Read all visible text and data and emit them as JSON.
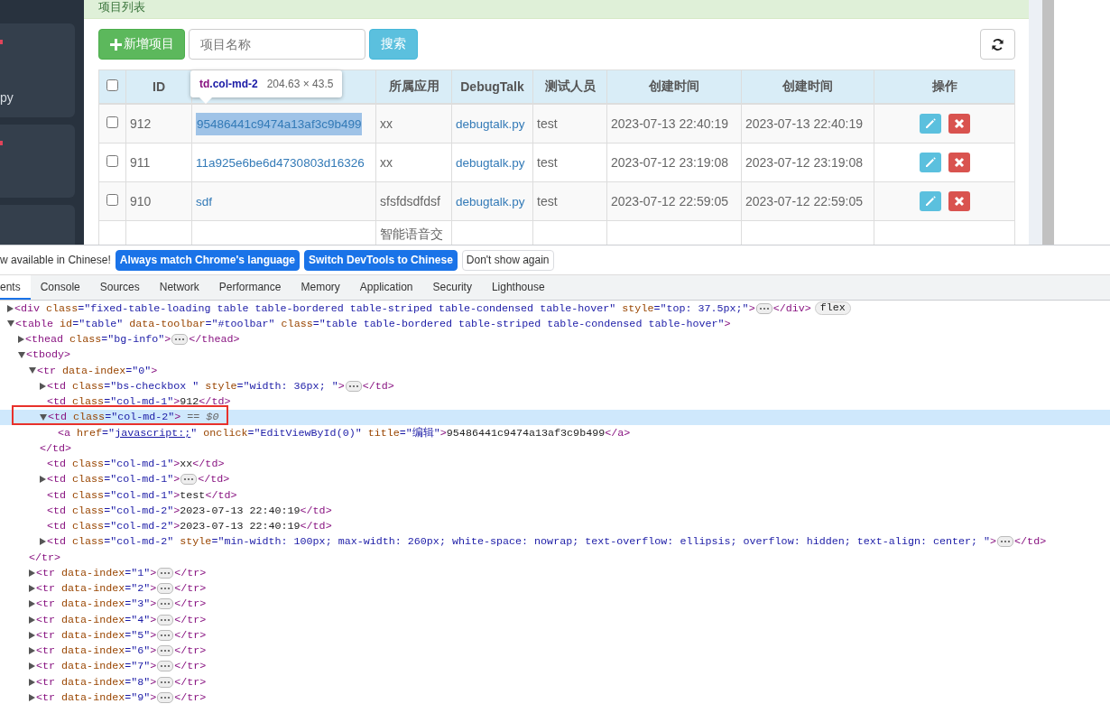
{
  "sidebar": {
    "cards": [
      {
        "label": "py",
        "marked": true
      },
      {
        "marked": true
      },
      {
        "marked": false
      }
    ]
  },
  "panel": {
    "title": "项目列表"
  },
  "toolbar": {
    "add_button": "新增项目",
    "search": {
      "placeholder": "项目名称"
    },
    "search_button": "搜索"
  },
  "table": {
    "columns": [
      {
        "kind": "checkbox",
        "checked": false
      },
      {
        "kind": "text",
        "label": "ID"
      },
      {
        "kind": "hidden"
      },
      {
        "kind": "text",
        "label": "所属应用"
      },
      {
        "kind": "text",
        "label": "DebugTalk"
      },
      {
        "kind": "text",
        "label": "测试人员"
      },
      {
        "kind": "text",
        "label": "创建时间"
      },
      {
        "kind": "text",
        "label": "创建时间"
      },
      {
        "kind": "text",
        "label": "操作"
      }
    ],
    "rows": [
      {
        "checked": false,
        "id": "912",
        "name": "95486441c9474a13af3c9b499",
        "inspected": true,
        "app": "xx",
        "debugtalk": "debugtalk.py",
        "tester": "test",
        "created": "2023-07-13 22:40:19",
        "created_2": "2023-07-13 22:40:19",
        "actions": [
          {
            "kind": "edit"
          },
          {
            "kind": "delete"
          }
        ]
      },
      {
        "checked": false,
        "id": "911",
        "name": "11a925e6be6d4730803d16326",
        "inspected": false,
        "app": "xx",
        "debugtalk": "debugtalk.py",
        "tester": "test",
        "created": "2023-07-12 23:19:08",
        "created_2": "2023-07-12 23:19:08",
        "actions": [
          {
            "kind": "edit"
          },
          {
            "kind": "delete"
          }
        ]
      },
      {
        "checked": false,
        "id": "910",
        "name": "sdf",
        "inspected": false,
        "app": "sfsfdsdfdsf",
        "debugtalk": "debugtalk.py",
        "tester": "test",
        "created": "2023-07-12 22:59:05",
        "created_2": "2023-07-12 22:59:05",
        "actions": [
          {
            "kind": "edit"
          },
          {
            "kind": "delete"
          }
        ]
      },
      {
        "app": "智能语音交",
        "inspected": false
      }
    ]
  },
  "tooltip": {
    "tag": "td",
    "selector": ".col-md-2",
    "size": "204.63 × 43.5"
  },
  "devtools": {
    "infobar": {
      "message": "w available in Chinese!",
      "buttons": [
        {
          "label": "Always match Chrome's language",
          "kind": "primary"
        },
        {
          "label": "Switch DevTools to Chinese",
          "kind": "primary"
        },
        {
          "label": "Don't show again",
          "kind": "secondary"
        }
      ]
    },
    "tabs": [
      {
        "label": "ents",
        "selected": true
      },
      {
        "label": "Console",
        "selected": false
      },
      {
        "label": "Sources",
        "selected": false
      },
      {
        "label": "Network",
        "selected": false
      },
      {
        "label": "Performance",
        "selected": false
      },
      {
        "label": "Memory",
        "selected": false
      },
      {
        "label": "Application",
        "selected": false
      },
      {
        "label": "Security",
        "selected": false
      },
      {
        "label": "Lighthouse",
        "selected": false
      }
    ],
    "tree": [
      {
        "kind": "closed",
        "selected": false,
        "boxed": false,
        "parts": [
          {
            "kind": "tag",
            "text": "<div"
          },
          {
            "kind": "attr",
            "text": " class"
          },
          {
            "kind": "value",
            "text": "=\"fixed-table-loading table table-bordered table-striped table-condensed table-hover\""
          },
          {
            "kind": "attr",
            "text": " style"
          },
          {
            "kind": "value",
            "text": "=\"top: 37.5px;\""
          },
          {
            "kind": "tag",
            "text": ">"
          },
          {
            "kind": "more"
          },
          {
            "kind": "tag",
            "text": "</div>"
          },
          {
            "kind": "badge",
            "text": "flex"
          }
        ]
      },
      {
        "kind": "open",
        "selected": false,
        "boxed": false,
        "parts": [
          {
            "kind": "tag",
            "text": "<table"
          },
          {
            "kind": "attr",
            "text": " id"
          },
          {
            "kind": "value",
            "text": "=\"table\""
          },
          {
            "kind": "attr",
            "text": " data-toolbar"
          },
          {
            "kind": "value",
            "text": "=\"#toolbar\""
          },
          {
            "kind": "attr",
            "text": " class"
          },
          {
            "kind": "value",
            "text": "=\"table table-bordered table-striped table-condensed table-hover\""
          },
          {
            "kind": "tag",
            "text": ">"
          }
        ],
        "children": [
          {
            "kind": "closed",
            "selected": false,
            "boxed": false,
            "parts": [
              {
                "kind": "tag",
                "text": "<thead"
              },
              {
                "kind": "attr",
                "text": " class"
              },
              {
                "kind": "value",
                "text": "=\"bg-info\""
              },
              {
                "kind": "tag",
                "text": ">"
              },
              {
                "kind": "more"
              },
              {
                "kind": "tag",
                "text": "</thead>"
              }
            ]
          },
          {
            "kind": "open",
            "selected": false,
            "boxed": false,
            "parts": [
              {
                "kind": "tag",
                "text": "<tbody>"
              }
            ],
            "children": [
              {
                "kind": "open",
                "selected": false,
                "boxed": false,
                "parts": [
                  {
                    "kind": "tag",
                    "text": "<tr"
                  },
                  {
                    "kind": "attr",
                    "text": " data-index"
                  },
                  {
                    "kind": "value",
                    "text": "=\"0\""
                  },
                  {
                    "kind": "tag",
                    "text": ">"
                  }
                ],
                "close": "</tr>",
                "children": [
                  {
                    "kind": "closed",
                    "selected": false,
                    "boxed": false,
                    "parts": [
                      {
                        "kind": "tag",
                        "text": "<td"
                      },
                      {
                        "kind": "attr",
                        "text": " class"
                      },
                      {
                        "kind": "value",
                        "text": "=\"bs-checkbox \""
                      },
                      {
                        "kind": "attr",
                        "text": " style"
                      },
                      {
                        "kind": "value",
                        "text": "=\"width: 36px; \""
                      },
                      {
                        "kind": "tag",
                        "text": ">"
                      },
                      {
                        "kind": "more"
                      },
                      {
                        "kind": "tag",
                        "text": "</td>"
                      }
                    ]
                  },
                  {
                    "kind": "leaf",
                    "selected": false,
                    "boxed": false,
                    "parts": [
                      {
                        "kind": "tag",
                        "text": "<td"
                      },
                      {
                        "kind": "attr",
                        "text": " class"
                      },
                      {
                        "kind": "value",
                        "text": "=\"col-md-1\""
                      },
                      {
                        "kind": "tag",
                        "text": ">"
                      },
                      {
                        "kind": "text",
                        "text": "912"
                      },
                      {
                        "kind": "tag",
                        "text": "</td>"
                      }
                    ]
                  },
                  {
                    "kind": "open",
                    "selected": true,
                    "boxed": true,
                    "parts": [
                      {
                        "kind": "tag",
                        "text": "<td"
                      },
                      {
                        "kind": "attr",
                        "text": " class"
                      },
                      {
                        "kind": "value",
                        "text": "=\"col-md-2\""
                      },
                      {
                        "kind": "tag",
                        "text": ">"
                      },
                      {
                        "kind": "hint",
                        "text": " == $0"
                      }
                    ],
                    "close": "</td>",
                    "children": [
                      {
                        "kind": "leaf",
                        "selected": false,
                        "boxed": false,
                        "parts": [
                          {
                            "kind": "tag",
                            "text": "<a"
                          },
                          {
                            "kind": "attr",
                            "text": " href"
                          },
                          {
                            "kind": "value",
                            "text": "=\""
                          },
                          {
                            "kind": "link",
                            "text": "javascript:;"
                          },
                          {
                            "kind": "value",
                            "text": "\""
                          },
                          {
                            "kind": "attr",
                            "text": " onclick"
                          },
                          {
                            "kind": "value",
                            "text": "=\"EditViewById(0)\""
                          },
                          {
                            "kind": "attr",
                            "text": " title"
                          },
                          {
                            "kind": "value",
                            "text": "=\"编辑\""
                          },
                          {
                            "kind": "tag",
                            "text": ">"
                          },
                          {
                            "kind": "text",
                            "text": "95486441c9474a13af3c9b499"
                          },
                          {
                            "kind": "tag",
                            "text": "</a>"
                          }
                        ]
                      }
                    ]
                  },
                  {
                    "kind": "leaf",
                    "selected": false,
                    "boxed": false,
                    "parts": [
                      {
                        "kind": "tag",
                        "text": "<td"
                      },
                      {
                        "kind": "attr",
                        "text": " class"
                      },
                      {
                        "kind": "value",
                        "text": "=\"col-md-1\""
                      },
                      {
                        "kind": "tag",
                        "text": ">"
                      },
                      {
                        "kind": "text",
                        "text": "xx"
                      },
                      {
                        "kind": "tag",
                        "text": "</td>"
                      }
                    ]
                  },
                  {
                    "kind": "closed",
                    "selected": false,
                    "boxed": false,
                    "parts": [
                      {
                        "kind": "tag",
                        "text": "<td"
                      },
                      {
                        "kind": "attr",
                        "text": " class"
                      },
                      {
                        "kind": "value",
                        "text": "=\"col-md-1\""
                      },
                      {
                        "kind": "tag",
                        "text": ">"
                      },
                      {
                        "kind": "more"
                      },
                      {
                        "kind": "tag",
                        "text": "</td>"
                      }
                    ]
                  },
                  {
                    "kind": "leaf",
                    "selected": false,
                    "boxed": false,
                    "parts": [
                      {
                        "kind": "tag",
                        "text": "<td"
                      },
                      {
                        "kind": "attr",
                        "text": " class"
                      },
                      {
                        "kind": "value",
                        "text": "=\"col-md-1\""
                      },
                      {
                        "kind": "tag",
                        "text": ">"
                      },
                      {
                        "kind": "text",
                        "text": "test"
                      },
                      {
                        "kind": "tag",
                        "text": "</td>"
                      }
                    ]
                  },
                  {
                    "kind": "leaf",
                    "selected": false,
                    "boxed": false,
                    "parts": [
                      {
                        "kind": "tag",
                        "text": "<td"
                      },
                      {
                        "kind": "attr",
                        "text": " class"
                      },
                      {
                        "kind": "value",
                        "text": "=\"col-md-2\""
                      },
                      {
                        "kind": "tag",
                        "text": ">"
                      },
                      {
                        "kind": "text",
                        "text": "2023-07-13 22:40:19"
                      },
                      {
                        "kind": "tag",
                        "text": "</td>"
                      }
                    ]
                  },
                  {
                    "kind": "leaf",
                    "selected": false,
                    "boxed": false,
                    "parts": [
                      {
                        "kind": "tag",
                        "text": "<td"
                      },
                      {
                        "kind": "attr",
                        "text": " class"
                      },
                      {
                        "kind": "value",
                        "text": "=\"col-md-2\""
                      },
                      {
                        "kind": "tag",
                        "text": ">"
                      },
                      {
                        "kind": "text",
                        "text": "2023-07-13 22:40:19"
                      },
                      {
                        "kind": "tag",
                        "text": "</td>"
                      }
                    ]
                  },
                  {
                    "kind": "closed",
                    "selected": false,
                    "boxed": false,
                    "parts": [
                      {
                        "kind": "tag",
                        "text": "<td"
                      },
                      {
                        "kind": "attr",
                        "text": " class"
                      },
                      {
                        "kind": "value",
                        "text": "=\"col-md-2\""
                      },
                      {
                        "kind": "attr",
                        "text": " style"
                      },
                      {
                        "kind": "value",
                        "text": "=\"min-width: 100px; max-width: 260px; white-space: nowrap; text-overflow: ellipsis; overflow: hidden; text-align: center; \""
                      },
                      {
                        "kind": "tag",
                        "text": ">"
                      },
                      {
                        "kind": "more"
                      },
                      {
                        "kind": "tag",
                        "text": "</td>"
                      }
                    ]
                  }
                ]
              },
              {
                "kind": "closed",
                "selected": false,
                "boxed": false,
                "parts": [
                  {
                    "kind": "tag",
                    "text": "<tr"
                  },
                  {
                    "kind": "attr",
                    "text": " data-index"
                  },
                  {
                    "kind": "value",
                    "text": "=\"1\""
                  },
                  {
                    "kind": "tag",
                    "text": ">"
                  },
                  {
                    "kind": "more"
                  },
                  {
                    "kind": "tag",
                    "text": "</tr>"
                  }
                ]
              },
              {
                "kind": "closed",
                "selected": false,
                "boxed": false,
                "parts": [
                  {
                    "kind": "tag",
                    "text": "<tr"
                  },
                  {
                    "kind": "attr",
                    "text": " data-index"
                  },
                  {
                    "kind": "value",
                    "text": "=\"2\""
                  },
                  {
                    "kind": "tag",
                    "text": ">"
                  },
                  {
                    "kind": "more"
                  },
                  {
                    "kind": "tag",
                    "text": "</tr>"
                  }
                ]
              },
              {
                "kind": "closed",
                "selected": false,
                "boxed": false,
                "parts": [
                  {
                    "kind": "tag",
                    "text": "<tr"
                  },
                  {
                    "kind": "attr",
                    "text": " data-index"
                  },
                  {
                    "kind": "value",
                    "text": "=\"3\""
                  },
                  {
                    "kind": "tag",
                    "text": ">"
                  },
                  {
                    "kind": "more"
                  },
                  {
                    "kind": "tag",
                    "text": "</tr>"
                  }
                ]
              },
              {
                "kind": "closed",
                "selected": false,
                "boxed": false,
                "parts": [
                  {
                    "kind": "tag",
                    "text": "<tr"
                  },
                  {
                    "kind": "attr",
                    "text": " data-index"
                  },
                  {
                    "kind": "value",
                    "text": "=\"4\""
                  },
                  {
                    "kind": "tag",
                    "text": ">"
                  },
                  {
                    "kind": "more"
                  },
                  {
                    "kind": "tag",
                    "text": "</tr>"
                  }
                ]
              },
              {
                "kind": "closed",
                "selected": false,
                "boxed": false,
                "parts": [
                  {
                    "kind": "tag",
                    "text": "<tr"
                  },
                  {
                    "kind": "attr",
                    "text": " data-index"
                  },
                  {
                    "kind": "value",
                    "text": "=\"5\""
                  },
                  {
                    "kind": "tag",
                    "text": ">"
                  },
                  {
                    "kind": "more"
                  },
                  {
                    "kind": "tag",
                    "text": "</tr>"
                  }
                ]
              },
              {
                "kind": "closed",
                "selected": false,
                "boxed": false,
                "parts": [
                  {
                    "kind": "tag",
                    "text": "<tr"
                  },
                  {
                    "kind": "attr",
                    "text": " data-index"
                  },
                  {
                    "kind": "value",
                    "text": "=\"6\""
                  },
                  {
                    "kind": "tag",
                    "text": ">"
                  },
                  {
                    "kind": "more"
                  },
                  {
                    "kind": "tag",
                    "text": "</tr>"
                  }
                ]
              },
              {
                "kind": "closed",
                "selected": false,
                "boxed": false,
                "parts": [
                  {
                    "kind": "tag",
                    "text": "<tr"
                  },
                  {
                    "kind": "attr",
                    "text": " data-index"
                  },
                  {
                    "kind": "value",
                    "text": "=\"7\""
                  },
                  {
                    "kind": "tag",
                    "text": ">"
                  },
                  {
                    "kind": "more"
                  },
                  {
                    "kind": "tag",
                    "text": "</tr>"
                  }
                ]
              },
              {
                "kind": "closed",
                "selected": false,
                "boxed": false,
                "parts": [
                  {
                    "kind": "tag",
                    "text": "<tr"
                  },
                  {
                    "kind": "attr",
                    "text": " data-index"
                  },
                  {
                    "kind": "value",
                    "text": "=\"8\""
                  },
                  {
                    "kind": "tag",
                    "text": ">"
                  },
                  {
                    "kind": "more"
                  },
                  {
                    "kind": "tag",
                    "text": "</tr>"
                  }
                ]
              },
              {
                "kind": "closed",
                "selected": false,
                "boxed": false,
                "parts": [
                  {
                    "kind": "tag",
                    "text": "<tr"
                  },
                  {
                    "kind": "attr",
                    "text": " data-index"
                  },
                  {
                    "kind": "value",
                    "text": "=\"9\""
                  },
                  {
                    "kind": "tag",
                    "text": ">"
                  },
                  {
                    "kind": "more"
                  },
                  {
                    "kind": "tag",
                    "text": "</tr>"
                  }
                ]
              }
            ]
          }
        ]
      }
    ]
  }
}
